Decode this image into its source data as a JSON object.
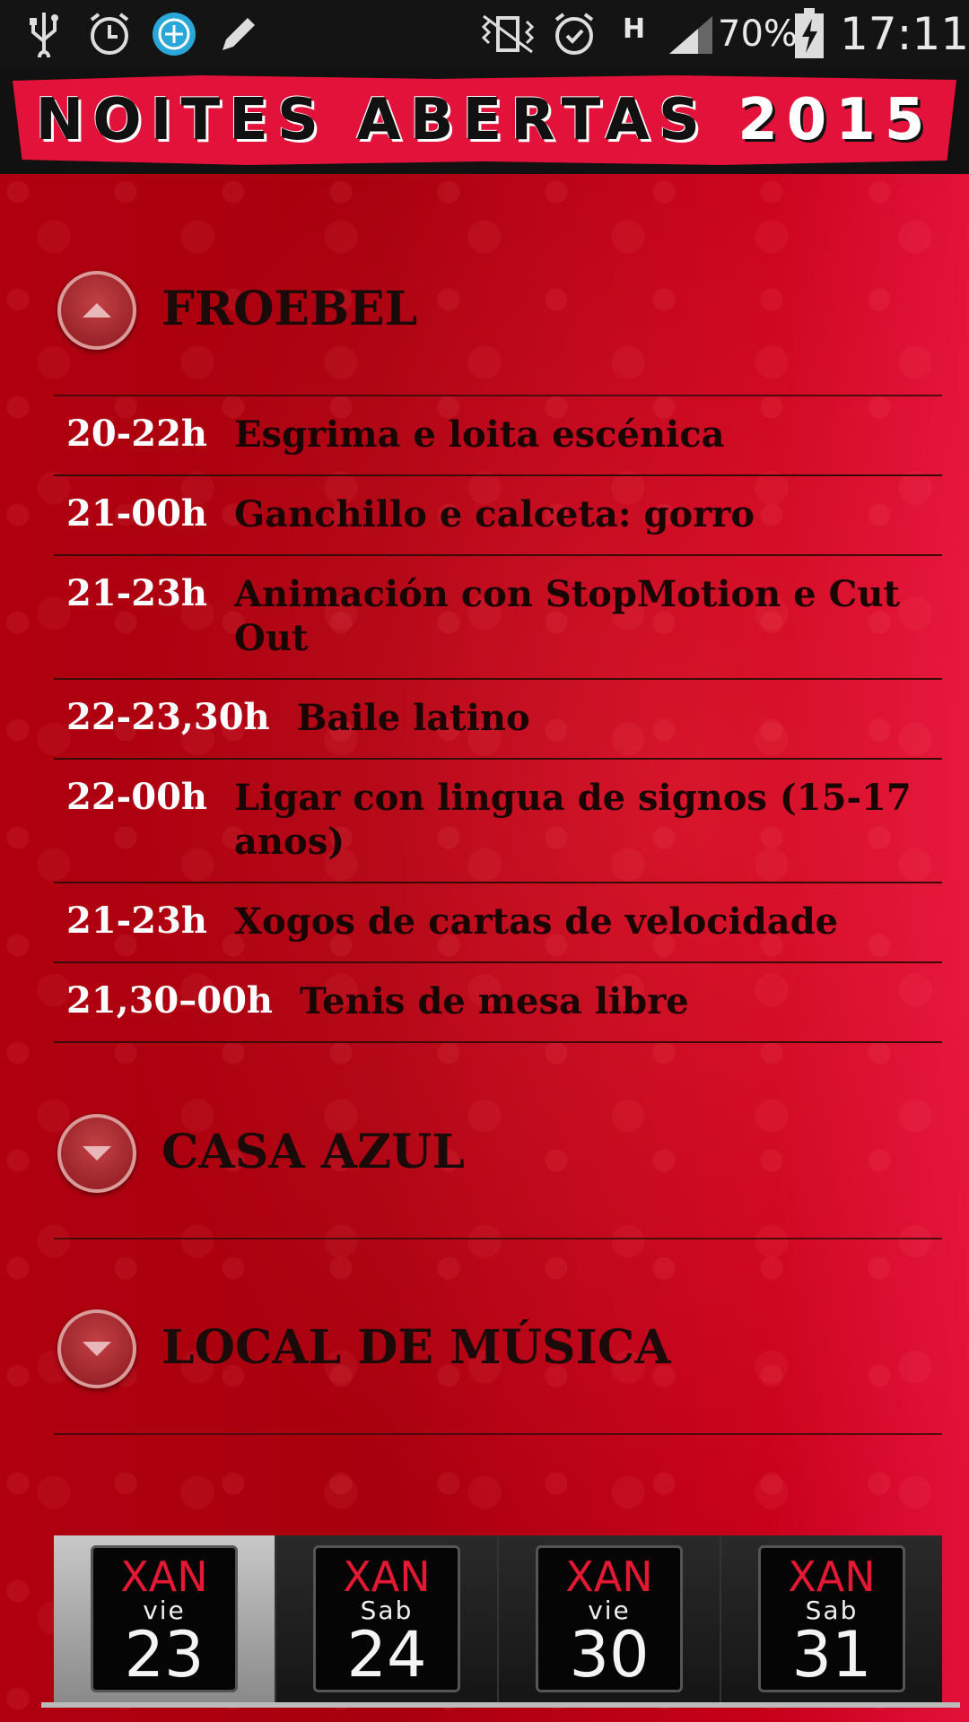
{
  "status_bar": {
    "battery": "70%",
    "time": "17:11",
    "network": "H",
    "icons": [
      "usb-icon",
      "alarm-icon",
      "sync-icon",
      "pencil-icon",
      "vibrate-icon",
      "alarm-clock-icon",
      "signal-icon",
      "battery-charging-icon"
    ]
  },
  "header": {
    "title": "NOITES ABERTAS",
    "year": "2015"
  },
  "sections": [
    {
      "name": "FROEBEL",
      "expanded": true,
      "events": [
        {
          "time": "20-22h",
          "title": "Esgrima e loita escénica"
        },
        {
          "time": "21-00h",
          "title": "Ganchillo e calceta: gorro"
        },
        {
          "time": "21-23h",
          "title": "Animación con StopMotion e Cut Out"
        },
        {
          "time": "22-23,30h",
          "title": "Baile latino"
        },
        {
          "time": "22-00h",
          "title": "Ligar con lingua de signos (15-17 anos)"
        },
        {
          "time": "21-23h",
          "title": "Xogos de cartas de velocidade"
        },
        {
          "time": "21,30–00h",
          "title": "Tenis de mesa libre"
        }
      ]
    },
    {
      "name": "CASA AZUL",
      "expanded": false
    },
    {
      "name": "LOCAL DE MÚSICA",
      "expanded": false
    }
  ],
  "tabs": [
    {
      "month": "XAN",
      "weekday": "vie",
      "day": "23",
      "active": true
    },
    {
      "month": "XAN",
      "weekday": "Sab",
      "day": "24",
      "active": false
    },
    {
      "month": "XAN",
      "weekday": "vie",
      "day": "30",
      "active": false
    },
    {
      "month": "XAN",
      "weekday": "Sab",
      "day": "31",
      "active": false
    }
  ],
  "colors": {
    "accent": "#e3123a",
    "background": "#b0000f",
    "tab_month": "#e31833"
  }
}
